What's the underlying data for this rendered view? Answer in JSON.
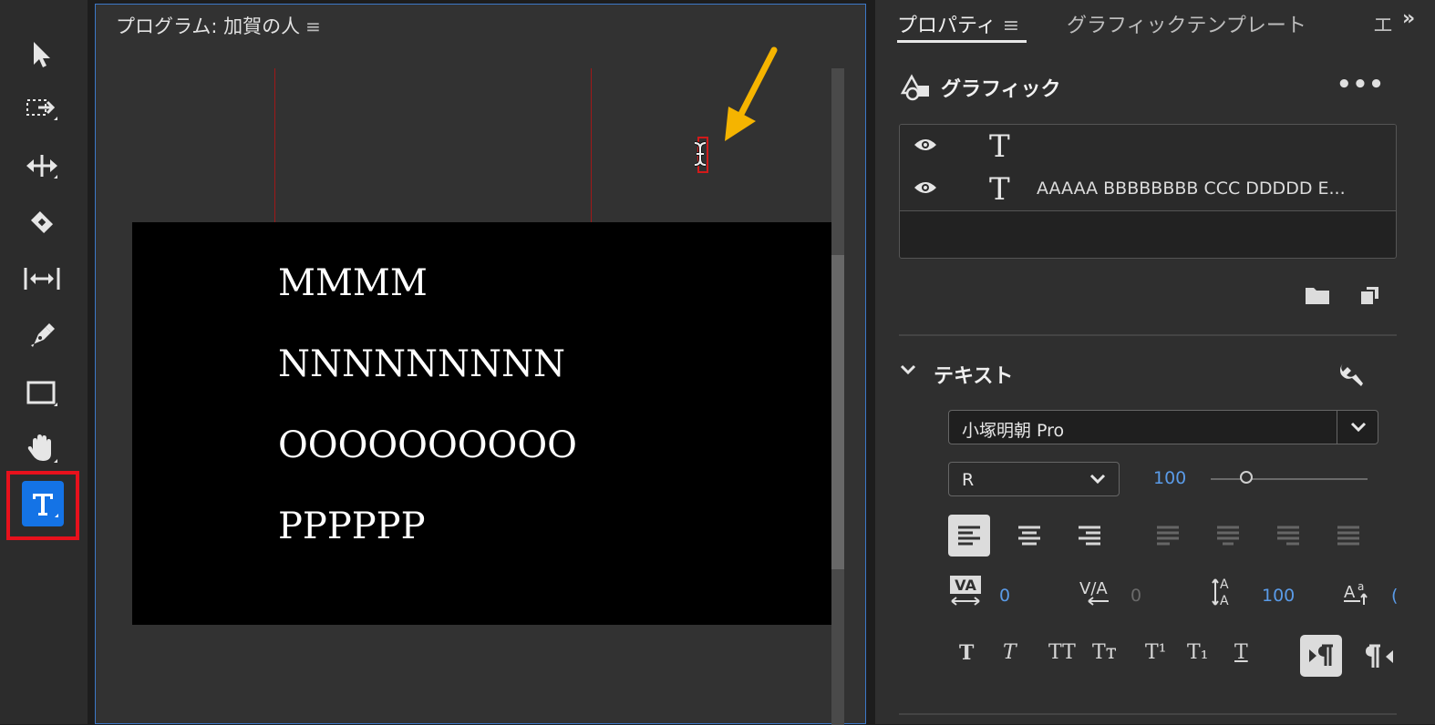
{
  "toolbar": {
    "tools": [
      {
        "name": "selection-tool",
        "icon": "arrow-pointer-icon"
      },
      {
        "name": "track-select-tool",
        "icon": "track-select-icon"
      },
      {
        "name": "ripple-edit-tool",
        "icon": "ripple-edit-icon"
      },
      {
        "name": "razor-tool",
        "icon": "razor-icon"
      },
      {
        "name": "slip-tool",
        "icon": "slip-icon"
      },
      {
        "name": "pen-tool",
        "icon": "pen-icon"
      },
      {
        "name": "rectangle-tool",
        "icon": "rectangle-icon"
      },
      {
        "name": "hand-tool",
        "icon": "hand-icon"
      },
      {
        "name": "type-tool",
        "icon": "type-icon",
        "selected": true
      }
    ],
    "highlight_color": "#e8111c",
    "selected_color": "#1473e6"
  },
  "program": {
    "title": "プログラム: 加賀の人",
    "menu_glyph": "≡",
    "frame_lines": [
      "MMMM",
      "NNNNNNNNN",
      "OOOOOOOOOO",
      "PPPPPP"
    ],
    "annotation_color": "#f5b400"
  },
  "properties": {
    "tabs": {
      "properties": "プロパティ",
      "properties_menu": "≡",
      "graphic_templates": "グラフィックテンプレート",
      "extra": "エ",
      "overflow": "»"
    },
    "graphic": {
      "title": "グラフィック",
      "more": "•••",
      "layers": [
        {
          "name": ""
        },
        {
          "name": "AAAAA BBBBBBBB CCC DDDDD E..."
        }
      ]
    },
    "text": {
      "title": "テキスト",
      "font_family": "小塚明朝 Pro",
      "font_style": "R",
      "font_size": "100",
      "kerning": "0",
      "tracking": "0",
      "leading": "100",
      "baseline_partial": "("
    },
    "style_glyphs": [
      "T",
      "T",
      "TT",
      "Tт",
      "T¹",
      "T₁",
      "T"
    ]
  }
}
